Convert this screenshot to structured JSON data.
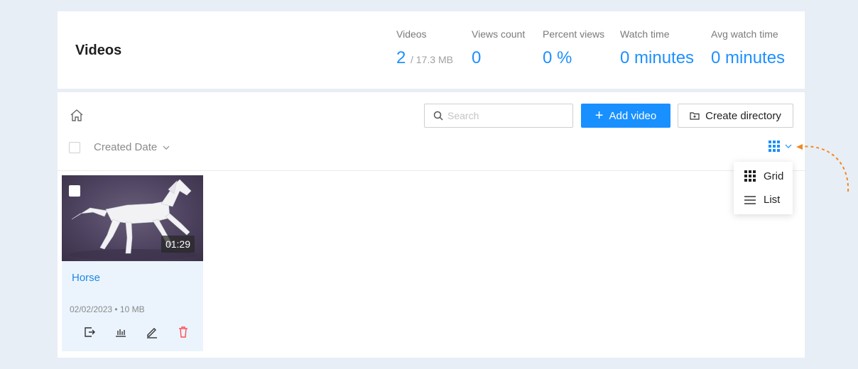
{
  "header": {
    "title": "Videos",
    "stats": [
      {
        "label": "Videos",
        "value": "2",
        "sub": "/ 17.3 MB"
      },
      {
        "label": "Views count",
        "value": "0",
        "sub": ""
      },
      {
        "label": "Percent views",
        "value": "0 %",
        "sub": ""
      },
      {
        "label": "Watch time",
        "value": "0 minutes",
        "sub": ""
      },
      {
        "label": "Avg watch time",
        "value": "0 minutes",
        "sub": ""
      }
    ]
  },
  "toolbar": {
    "search_placeholder": "Search",
    "add_video_label": "Add video",
    "create_directory_label": "Create directory",
    "sort_label": "Created Date"
  },
  "videos": [
    {
      "title": "Horse",
      "duration": "01:29",
      "date": "02/02/2023",
      "size": "10 MB",
      "meta": "02/02/2023 • 10 MB"
    }
  ],
  "view_menu": {
    "items": [
      {
        "label": "Grid",
        "icon": "grid-icon"
      },
      {
        "label": "List",
        "icon": "list-icon"
      }
    ]
  },
  "colors": {
    "accent": "#1890ff",
    "stat_value": "#1e90ff",
    "delete": "#ff4d4f",
    "annotation": "#f08a24"
  }
}
